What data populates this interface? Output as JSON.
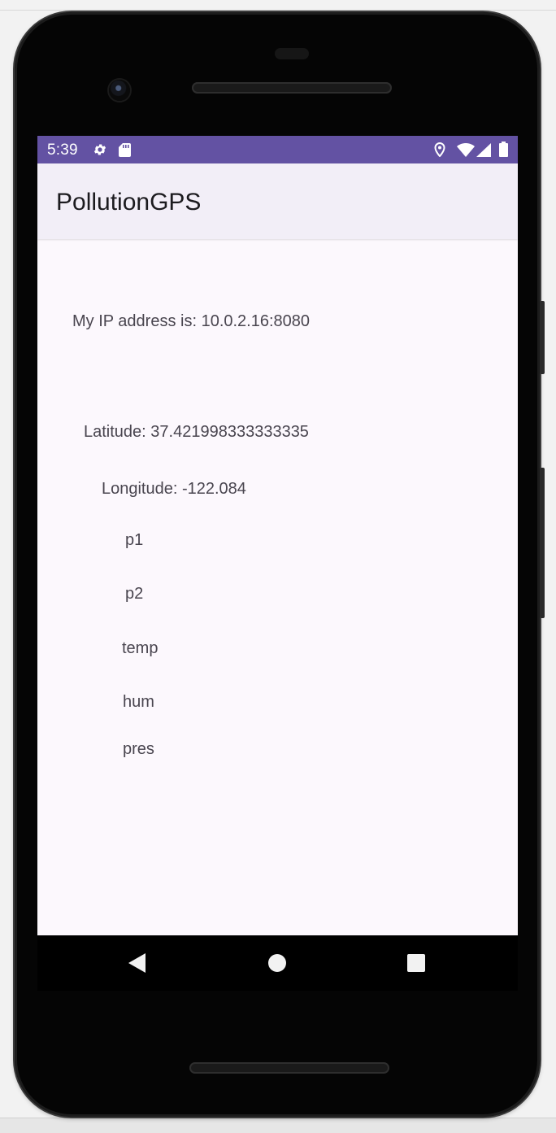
{
  "status_bar": {
    "time": "5:39",
    "background_color": "#6352a3",
    "icons": [
      "gear-icon",
      "sd-card-icon",
      "location-icon",
      "wifi-icon",
      "signal-icon",
      "battery-icon"
    ]
  },
  "app_bar": {
    "title": "PollutionGPS",
    "background_color": "#f2eef7"
  },
  "content": {
    "ip_address": "My IP address is: 10.0.2.16:8080",
    "latitude": "Latitude: 37.421998333333335",
    "longitude": "Longitude: -122.084",
    "p1": "p1",
    "p2": "p2",
    "temp": "temp",
    "hum": "hum",
    "pres": "pres"
  },
  "nav_bar": {
    "icons": [
      "back-icon",
      "home-icon",
      "recents-icon"
    ]
  }
}
